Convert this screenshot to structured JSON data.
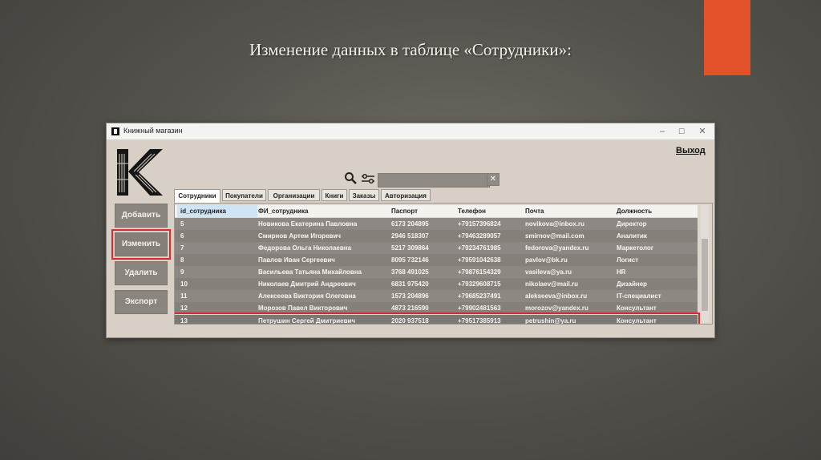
{
  "slide": {
    "title": "Изменение данных в таблице «Сотрудники»:",
    "accent_color": "#e2522a"
  },
  "window": {
    "title": "Книжный магазин",
    "controls": {
      "minimize": "–",
      "maximize": "☐",
      "close": "✕"
    }
  },
  "app": {
    "logo_icon": "bookstore-k-logo",
    "exit_label": "Выход",
    "search": {
      "value": "",
      "placeholder": "",
      "clear_label": "✕",
      "icon": "search-icon",
      "filter_icon": "filter-icon"
    },
    "buttons": {
      "add": "Добавить",
      "edit": "Изменить",
      "delete": "Удалить",
      "export": "Экспорт"
    },
    "tabs": [
      {
        "label": "Сотрудники",
        "active": true
      },
      {
        "label": "Покупатели",
        "active": false
      },
      {
        "label": "Организации",
        "active": false
      },
      {
        "label": "Книги",
        "active": false
      },
      {
        "label": "Заказы",
        "active": false
      },
      {
        "label": "Авторизация",
        "active": false
      }
    ],
    "table": {
      "columns": [
        "id_сотрудника",
        "ФИ_сотрудника",
        "Паспорт",
        "Телефон",
        "Почта",
        "Должность"
      ],
      "rows": [
        [
          "5",
          "Новикова Екатерина Павловна",
          "6173 204895",
          "+79157396824",
          "novikova@inbox.ru",
          "Директор"
        ],
        [
          "6",
          "Смирнов Артем Игоревич",
          "2946 518307",
          "+79463289057",
          "smirnov@mail.com",
          "Аналитик"
        ],
        [
          "7",
          "Федорова Ольга Николаевна",
          "5217 309864",
          "+79234761985",
          "fedorova@yandex.ru",
          "Маркетолог"
        ],
        [
          "8",
          "Павлов Иван Сергеевич",
          "8095 732146",
          "+79591042638",
          "pavlov@bk.ru",
          "Логист"
        ],
        [
          "9",
          "Васильева Татьяна Михайловна",
          "3768 491025",
          "+79876154329",
          "vasileva@ya.ru",
          "HR"
        ],
        [
          "10",
          "Николаев Дмитрий Андреевич",
          "6831 975420",
          "+79329608715",
          "nikolaev@mail.ru",
          "Дизайнер"
        ],
        [
          "11",
          "Алексеева Виктория Олеговна",
          "1573 204896",
          "+79685237491",
          "alekseeva@inbox.ru",
          "IT-специалист"
        ],
        [
          "12",
          "Морозов Павел Викторович",
          "4873 216590",
          "+79902481563",
          "morozov@yandex.ru",
          "Консультант"
        ],
        [
          "13",
          "Петрушин Сергей Дмитриевич",
          "2020 937518",
          "+79517385913",
          "petrushin@ya.ru",
          "Консультант"
        ]
      ],
      "selected_row": 8
    }
  }
}
